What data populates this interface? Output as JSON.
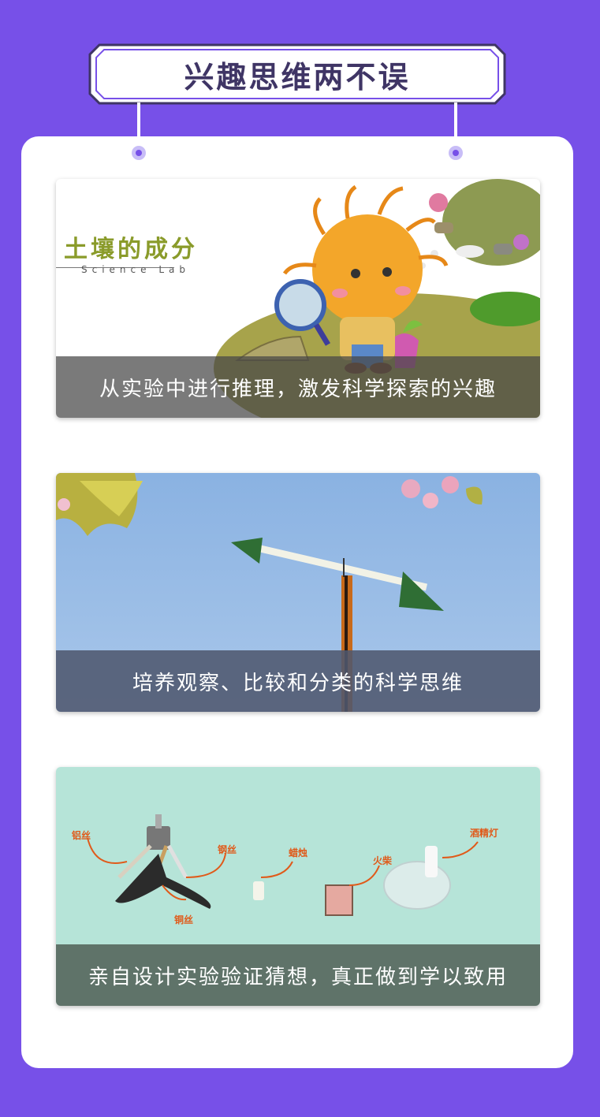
{
  "header": {
    "title": "兴趣思维两不误"
  },
  "panels": [
    {
      "logo_title": "土壤的成分",
      "logo_subtitle": "Science Lab",
      "caption": "从实验中进行推理，激发科学探索的兴趣"
    },
    {
      "caption": "培养观察、比较和分类的科学思维"
    },
    {
      "labels": {
        "aluminum_wire": "铝丝",
        "steel_wire": "钢丝",
        "copper_wire": "铜丝",
        "candle": "蜡烛",
        "matches": "火柴",
        "alcohol_lamp": "酒精灯"
      },
      "caption": "亲自设计实验验证猜想，真正做到学以致用"
    }
  ],
  "colors": {
    "background": "#7750e8",
    "card": "#ffffff",
    "title_text": "#3f3565",
    "label_orange": "#e05a1a"
  }
}
